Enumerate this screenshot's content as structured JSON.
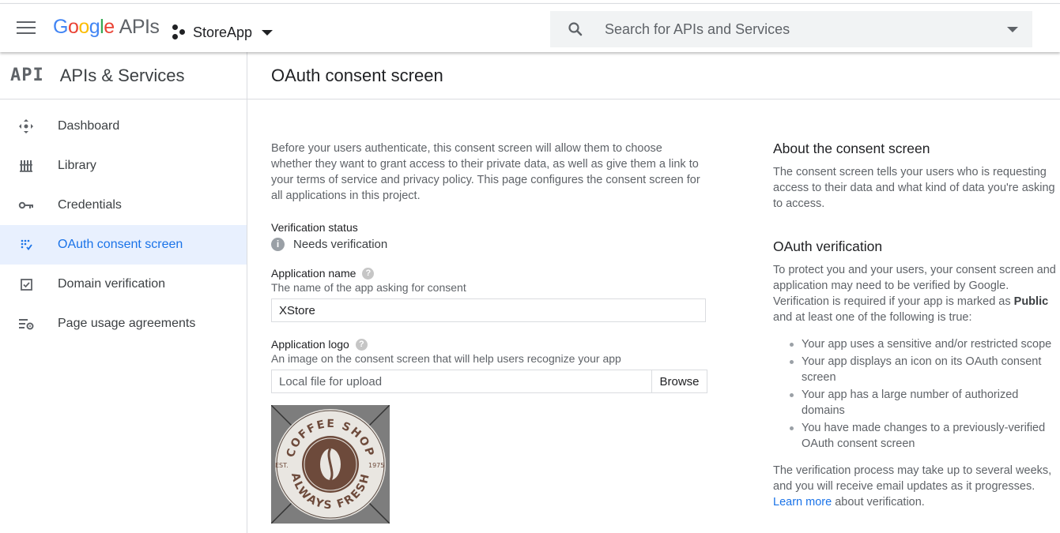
{
  "header": {
    "logo_google": "Google",
    "logo_apis": "APIs",
    "project_name": "StoreApp",
    "search_placeholder": "Search for APIs and Services"
  },
  "sidebar": {
    "section_icon": "API",
    "title": "APIs & Services",
    "items": [
      {
        "label": "Dashboard",
        "icon": "dashboard-icon"
      },
      {
        "label": "Library",
        "icon": "library-icon"
      },
      {
        "label": "Credentials",
        "icon": "key-icon"
      },
      {
        "label": "OAuth consent screen",
        "icon": "consent-icon",
        "active": true
      },
      {
        "label": "Domain verification",
        "icon": "checkbox-icon"
      },
      {
        "label": "Page usage agreements",
        "icon": "settings-list-icon"
      }
    ]
  },
  "main": {
    "title": "OAuth consent screen",
    "intro": "Before your users authenticate, this consent screen will allow them to choose whether they want to grant access to their private data, as well as give them a link to your terms of service and privacy policy. This page configures the consent screen for all applications in this project.",
    "verification": {
      "label": "Verification status",
      "value": "Needs verification"
    },
    "app_name": {
      "label": "Application name",
      "hint": "The name of the app asking for consent",
      "value": "XStore"
    },
    "app_logo": {
      "label": "Application logo",
      "hint": "An image on the consent screen that will help users recognize your app",
      "placeholder": "Local file for upload",
      "browse_label": "Browse",
      "image_top_text": "COFFEE SHOP",
      "image_bottom_text": "ALWAYS FRESH",
      "image_left_text": "EST.",
      "image_right_text": "1975"
    }
  },
  "aside": {
    "about_title": "About the consent screen",
    "about_text": "The consent screen tells your users who is requesting access to their data and what kind of data you're asking to access.",
    "verify_title": "OAuth verification",
    "verify_text_1": "To protect you and your users, your consent screen and application may need to be verified by Google. Verification is required if your app is marked as",
    "verify_bold": "Public",
    "verify_text_2": "and at least one of the following is true:",
    "bullets": [
      "Your app uses a sensitive and/or restricted scope",
      "Your app displays an icon on its OAuth consent screen",
      "Your app has a large number of authorized domains",
      "You have made changes to a previously-verified OAuth consent screen"
    ],
    "footer_text_1": "The verification process may take up to several weeks, and you will receive email updates as it progresses.",
    "learn_more": "Learn more",
    "footer_text_2": "about verification."
  },
  "colors": {
    "accent": "#1a73e8",
    "active_bg": "#e8f0fe"
  }
}
